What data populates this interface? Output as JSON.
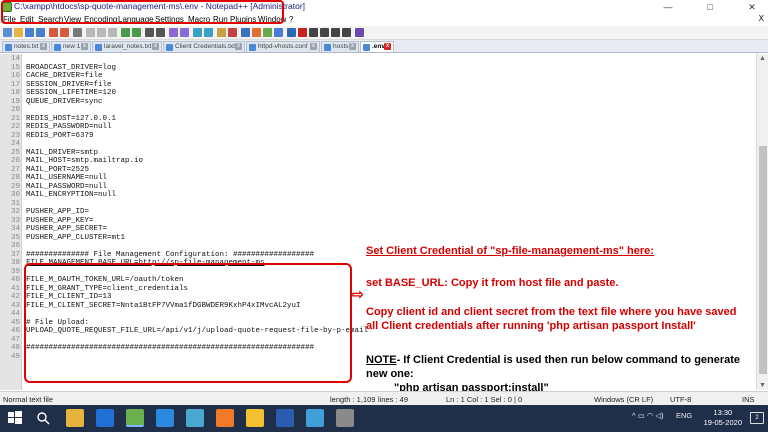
{
  "window": {
    "title": "C:\\xampp\\htdocs\\sp-quote-management-ms\\.env - Notepad++ [Administrator]",
    "controls": {
      "minimize": "—",
      "maximize": "□",
      "close": "✕"
    }
  },
  "menu": {
    "items": [
      "File",
      "Edit",
      "Search",
      "View",
      "Encoding",
      "Language",
      "Settings",
      "Macro",
      "Run",
      "Plugins",
      "Window",
      "?"
    ],
    "close_x": "X"
  },
  "tabs": [
    {
      "label": "notes.txt",
      "active": false
    },
    {
      "label": "new 1",
      "active": false
    },
    {
      "label": "laravel_notes.txt",
      "active": false
    },
    {
      "label": "Client Credentials.txt",
      "active": false
    },
    {
      "label": "httpd-vhosts.conf",
      "active": false
    },
    {
      "label": "hosts",
      "active": false
    },
    {
      "label": ".env",
      "active": true
    }
  ],
  "editor": {
    "lines": [
      {
        "n": "14",
        "t": ""
      },
      {
        "n": "15",
        "t": "BROADCAST_DRIVER=log"
      },
      {
        "n": "16",
        "t": "CACHE_DRIVER=file"
      },
      {
        "n": "17",
        "t": "SESSION_DRIVER=file"
      },
      {
        "n": "18",
        "t": "SESSION_LIFETIME=120"
      },
      {
        "n": "19",
        "t": "QUEUE_DRIVER=sync"
      },
      {
        "n": "20",
        "t": ""
      },
      {
        "n": "21",
        "t": "REDIS_HOST=127.0.0.1"
      },
      {
        "n": "22",
        "t": "REDIS_PASSWORD=null"
      },
      {
        "n": "23",
        "t": "REDIS_PORT=6379"
      },
      {
        "n": "24",
        "t": ""
      },
      {
        "n": "25",
        "t": "MAIL_DRIVER=smtp"
      },
      {
        "n": "26",
        "t": "MAIL_HOST=smtp.mailtrap.io"
      },
      {
        "n": "27",
        "t": "MAIL_PORT=2525"
      },
      {
        "n": "28",
        "t": "MAIL_USERNAME=null"
      },
      {
        "n": "29",
        "t": "MAIL_PASSWORD=null"
      },
      {
        "n": "30",
        "t": "MAIL_ENCRYPTION=null"
      },
      {
        "n": "31",
        "t": ""
      },
      {
        "n": "32",
        "t": "PUSHER_APP_ID="
      },
      {
        "n": "33",
        "t": "PUSHER_APP_KEY="
      },
      {
        "n": "34",
        "t": "PUSHER_APP_SECRET="
      },
      {
        "n": "35",
        "t": "PUSHER_APP_CLUSTER=mt1"
      },
      {
        "n": "36",
        "t": ""
      },
      {
        "n": "37",
        "t": "############## File Management Configuration: ##################"
      },
      {
        "n": "38",
        "t": "FILE_MANAGEMENT_BASE_URL=http://sp-file-management-ms"
      },
      {
        "n": "39",
        "t": ""
      },
      {
        "n": "40",
        "t": "FILE_M_OAUTH_TOKEN_URL=/oauth/token"
      },
      {
        "n": "41",
        "t": "FILE_M_GRANT_TYPE=client_credentials"
      },
      {
        "n": "42",
        "t": "FILE_M_CLIENT_ID=13"
      },
      {
        "n": "43",
        "t": "FILE_M_CLIENT_SECRET=Nnta1BtFP7VVma1fDGBWDER9KxhP4xIMvcAL2yuI"
      },
      {
        "n": "44",
        "t": ""
      },
      {
        "n": "45",
        "t": "# File Upload:"
      },
      {
        "n": "46",
        "t": "UPLOAD_QUOTE_REQUEST_FILE_URL=/api/v1/j/upload-quote-request-file-by-p-email"
      },
      {
        "n": "47",
        "t": ""
      },
      {
        "n": "48",
        "t": "################################################################"
      },
      {
        "n": "49",
        "t": ""
      }
    ]
  },
  "annotations": {
    "heading": "Set Client Credential of \"sp-file-management-ms\" here:",
    "base_url": "set BASE_URL: Copy it from host file and paste.",
    "copy_line1": "Copy client id and client secret from the text file where you have saved",
    "copy_line2": "all Client credentials after running 'php artisan passport Install'",
    "note_label": "NOTE",
    "note_line1": "- If Client Credential is used then run below command to generate",
    "note_line2": "new one:",
    "command": "\"php artisan passport:install\""
  },
  "statusbar": {
    "file_type": "Normal text file",
    "length": "length : 1,109",
    "lines": "lines : 49",
    "position": "Ln : 1    Col : 1    Sel : 0 | 0",
    "eol": "Windows (CR LF)",
    "encoding": "UTF-8",
    "mode": "INS"
  },
  "taskbar": {
    "lang": "ENG",
    "time": "13:30",
    "date": "19-05-2020",
    "notifications": "2"
  }
}
